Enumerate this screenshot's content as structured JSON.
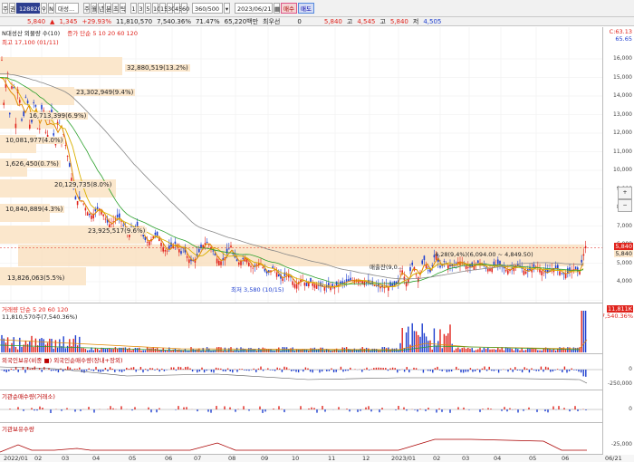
{
  "toolbar": {
    "mode_buttons": [
      "주",
      "권"
    ],
    "stock_code": "128820",
    "stock_name_label": "N",
    "stock_name": "대성...",
    "period_buttons": [
      "주",
      "월",
      "년",
      "분",
      "초",
      "틱"
    ],
    "interval_buttons": [
      "1",
      "3",
      "5",
      "10",
      "15",
      "30",
      "45",
      "60"
    ],
    "count_value": "360/500",
    "date_value": "2023/06/21",
    "buy_label": "매수",
    "sell_label": "매도"
  },
  "quote": {
    "price": "5,840",
    "change": "1,345",
    "change_pct": "+29.93%",
    "volume": "11,810,570",
    "vol_ratio": "7,540.36%",
    "turnover": "71.47%",
    "amount": "65,220백만",
    "priority_label": "최우선",
    "priority_value": "0",
    "open": "5,840",
    "high_label": "고",
    "high": "4,545",
    "low_label": "고",
    "low": "5,840",
    "close_label": "저",
    "close": "4,505"
  },
  "price_pane": {
    "legend_stock": "N대성산 외물량 수(10)",
    "legend_ma": "증가 단순 5  10  20  60  120",
    "high_label": "최고 17,100 (01/11)",
    "low_label": "최저 3,580 (10/15)",
    "box_label": "매출잔(9,0...",
    "right_box_label": "4,28(9,4%)(6,094.00 ~ 4,849.50)",
    "annotations": [
      {
        "text": "32,880,519(13.2%)"
      },
      {
        "text": "23,302,949(9.4%)"
      },
      {
        "text": "16,713,399(6.9%)"
      },
      {
        "text": "10,081,977(4.0%)"
      },
      {
        "text": "1,626,450(0.7%)"
      },
      {
        "text": "20,129,735(8.0%)"
      },
      {
        "text": "10,840,889(4.3%)"
      },
      {
        "text": "23,925,517(9.6%)"
      },
      {
        "text": "13,826,063(5.5%)"
      }
    ],
    "y_ticks": [
      "16,000",
      "15,000",
      "14,000",
      "13,000",
      "12,000",
      "11,000",
      "10,000",
      "9,000",
      "8,000",
      "7,000",
      "6,000",
      "5,000",
      "4,000"
    ],
    "top_values": [
      "C:63.13",
      "65.65"
    ],
    "price_marker": "5,840",
    "price_marker2": "5,840"
  },
  "volume_pane": {
    "legend": "거래량 단순 5  20  60  120",
    "legend2": "11,810,570주(7,540.36%)",
    "marker": "11,811K",
    "marker2": "7,540.36%"
  },
  "foreign_pane": {
    "legend": "외국인보유(비중 ■) 외국인순매수량(장내+장외)",
    "zero": "0",
    "tick": "-250,000"
  },
  "inst_pane": {
    "legend": "기관순매수량(거래소)",
    "zero": "0"
  },
  "inst_hold_pane": {
    "legend": "기관보유수량",
    "tick": "-25,000"
  },
  "x_axis": {
    "labels": [
      "2022/01",
      "02",
      "03",
      "04",
      "05",
      "06",
      "07",
      "08",
      "09",
      "10",
      "11",
      "12",
      "2023/01",
      "02",
      "03",
      "04",
      "05",
      "06",
      "06/21"
    ]
  },
  "colors": {
    "up": "#e0231c",
    "down": "#1f3fcf",
    "ma5": "#e08a00",
    "ma20": "#2ca02c",
    "ma60": "#888888",
    "box": "#fbe7cc"
  }
}
